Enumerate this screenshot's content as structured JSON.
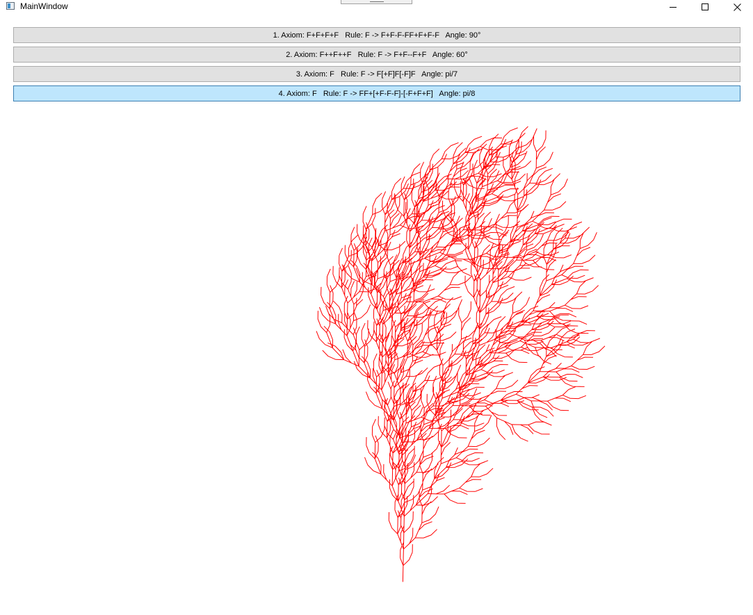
{
  "window": {
    "title": "MainWindow",
    "controls": [
      "minimize-icon",
      "maximize-icon",
      "close-icon"
    ]
  },
  "buttons": [
    {
      "label": "1. Axiom: F+F+F+F   Rule: F -> F+F-F-FF+F+F-F   Angle: 90°"
    },
    {
      "label": "2. Axiom: F++F++F   Rule: F -> F+F--F+F   Angle: 60°"
    },
    {
      "label": "3. Axiom: F   Rule: F -> F[+F]F[-F]F   Angle: pi/7"
    },
    {
      "label": "4. Axiom: F   Rule: F -> FF+[+F-F-F]-[-F+F+F]   Angle: pi/8"
    }
  ],
  "selected_button": 4,
  "drawing": {
    "stroke_color": "#ff0000",
    "axiom": "F",
    "rule": "FF+[+F-F-F]-[-F+F+F]",
    "angle": "pi/8"
  }
}
